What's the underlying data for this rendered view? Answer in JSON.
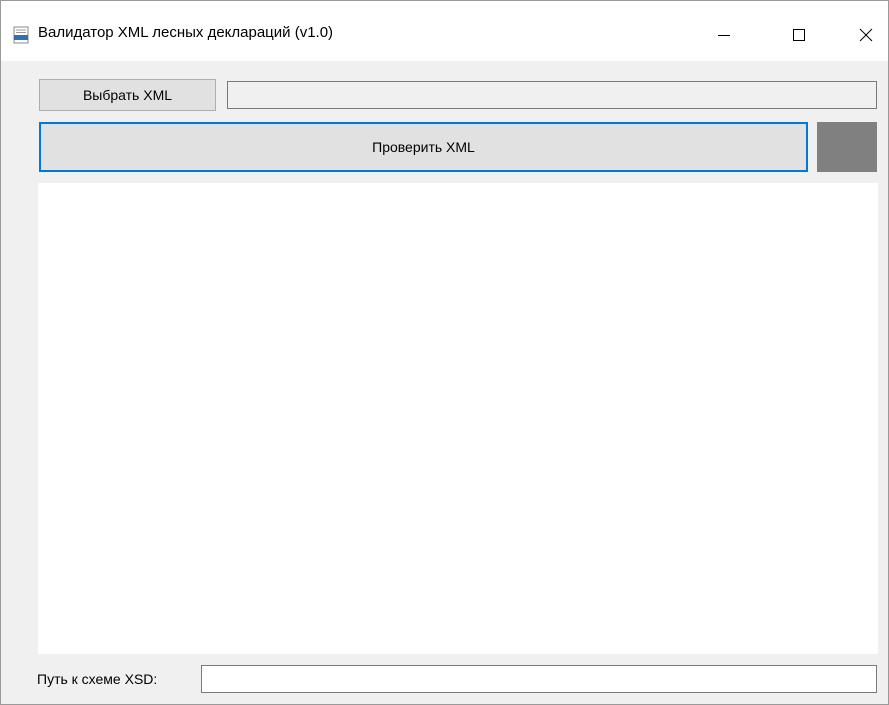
{
  "window": {
    "title": "Валидатор XML лесных деклараций (v1.0)",
    "icon": "xml-file-icon"
  },
  "toolbar": {
    "select_label": "Выбрать XML",
    "selected_path": "",
    "check_label": "Проверить XML",
    "status_color": "#808080"
  },
  "output": {
    "text": ""
  },
  "footer": {
    "xsd_label": "Путь к схеме XSD:",
    "xsd_path": ""
  },
  "colors": {
    "focus_border": "#0078d7",
    "window_bg": "#f0f0f0"
  }
}
